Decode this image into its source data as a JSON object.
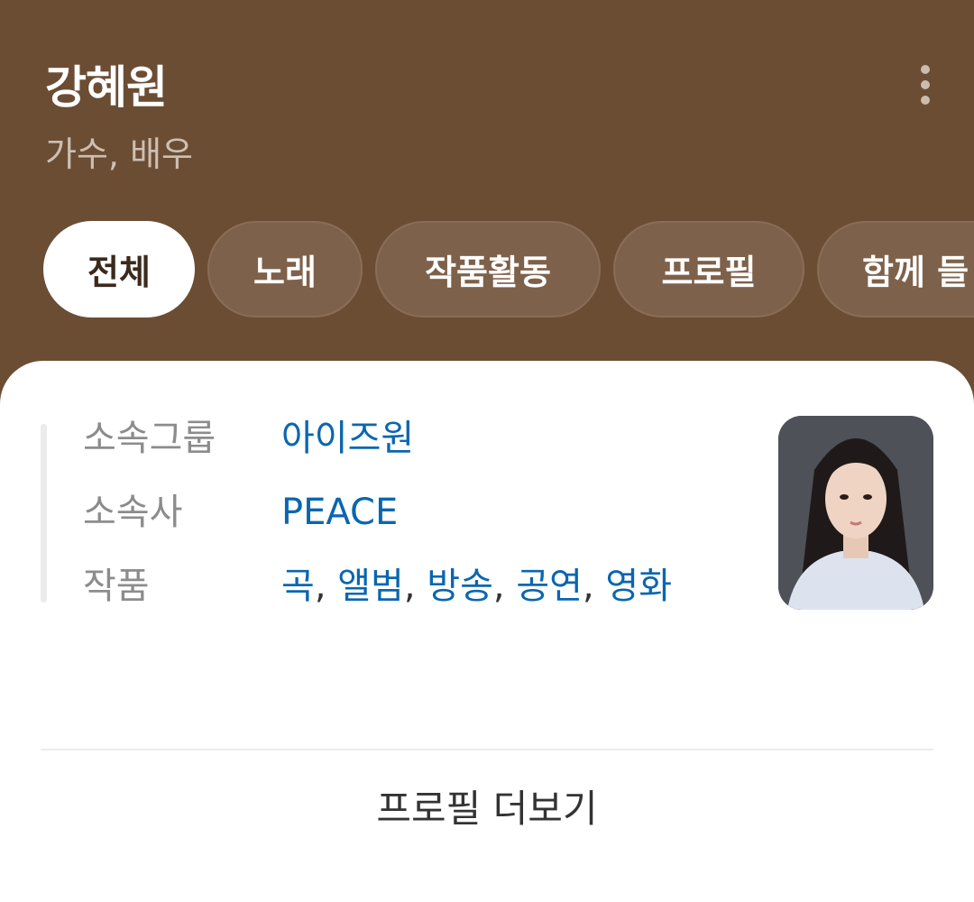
{
  "header": {
    "name": "강혜원",
    "subtitle": "가수, 배우",
    "more_icon": "more-vertical-icon"
  },
  "tabs": [
    {
      "label": "전체",
      "active": true
    },
    {
      "label": "노래",
      "active": false
    },
    {
      "label": "작품활동",
      "active": false
    },
    {
      "label": "프로필",
      "active": false
    },
    {
      "label": "함께 들",
      "active": false
    }
  ],
  "profile": {
    "rows": [
      {
        "label": "소속그룹",
        "value": "아이즈원"
      },
      {
        "label": "소속사",
        "value": "PEACE"
      },
      {
        "label": "작품",
        "works": [
          "곡",
          "앨범",
          "방송",
          "공연",
          "영화"
        ]
      }
    ],
    "photo_alt": "강혜원",
    "more_label": "프로필 더보기"
  },
  "colors": {
    "header_bg": "#6b4d34",
    "tab_bg": "#7e614a",
    "link": "#0a66b0",
    "label": "#8c8c8c"
  }
}
